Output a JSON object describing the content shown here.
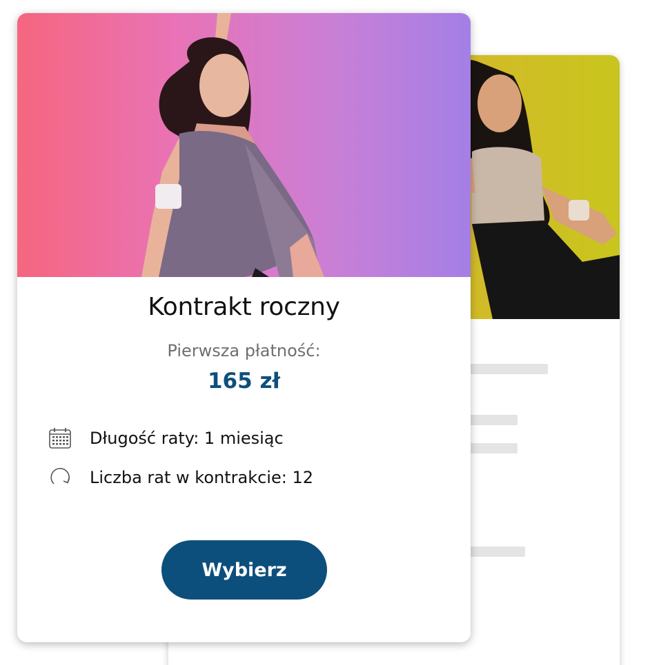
{
  "front_card": {
    "title": "Kontrakt roczny",
    "first_payment_label": "Pierwsza płatność:",
    "price": "165 zł",
    "features": [
      {
        "icon": "calendar-icon",
        "text": "Długość raty: 1 miesiąc"
      },
      {
        "icon": "renew-icon",
        "text": "Liczba rat w kontrakcie: 12"
      }
    ],
    "button_label": "Wybierz"
  },
  "colors": {
    "accent": "#0d4f7c",
    "muted_text": "#6f6f6f",
    "front_gradient_start": "#f5667f",
    "front_gradient_end": "#a47fe6",
    "back_photo_background": "#d9b230",
    "skeleton": "#e4e4e4"
  }
}
